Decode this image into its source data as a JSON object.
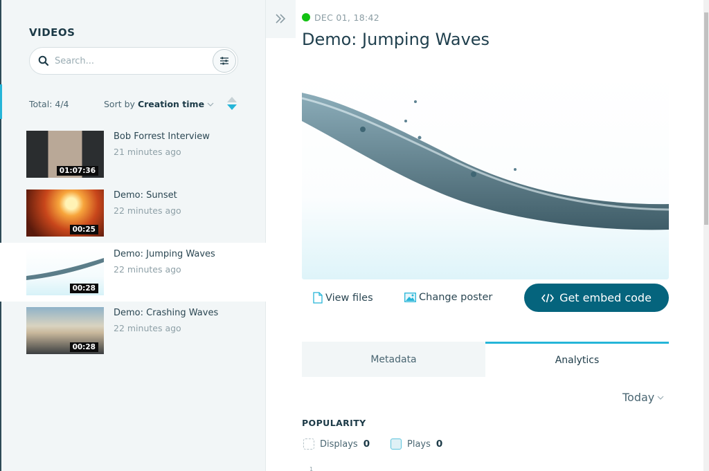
{
  "sidebar": {
    "title": "VIDEOS",
    "search": {
      "placeholder": "Search...",
      "value": ""
    },
    "total_label": "Total: 4/4",
    "sort": {
      "prefix": "Sort by",
      "field": "Creation time",
      "direction": "descending"
    },
    "items": [
      {
        "title": "Bob Forrest Interview",
        "time": "21 minutes ago",
        "duration": "01:07:36",
        "active": false
      },
      {
        "title": "Demo: Sunset",
        "time": "22 minutes ago",
        "duration": "00:25",
        "active": false
      },
      {
        "title": "Demo: Jumping Waves",
        "time": "22 minutes ago",
        "duration": "00:28",
        "active": true
      },
      {
        "title": "Demo: Crashing Waves",
        "time": "22 minutes ago",
        "duration": "00:28",
        "active": false
      }
    ]
  },
  "main": {
    "status_color": "#13c213",
    "date": "DEC 01, 18:42",
    "title": "Demo: Jumping Waves",
    "actions": {
      "view_files": "View files",
      "change_poster": "Change poster",
      "embed": "Get embed code"
    },
    "tabs": [
      {
        "label": "Metadata",
        "active": false
      },
      {
        "label": "Analytics",
        "active": true
      }
    ],
    "range": "Today",
    "popularity": {
      "title": "POPULARITY",
      "legend": [
        {
          "label": "Displays",
          "value": "0"
        },
        {
          "label": "Plays",
          "value": "0"
        }
      ],
      "axis_tick": "1"
    }
  },
  "colors": {
    "accent": "#25b5d8",
    "primary_button": "#05647d",
    "sidebar_bg": "#f2f6f7"
  }
}
